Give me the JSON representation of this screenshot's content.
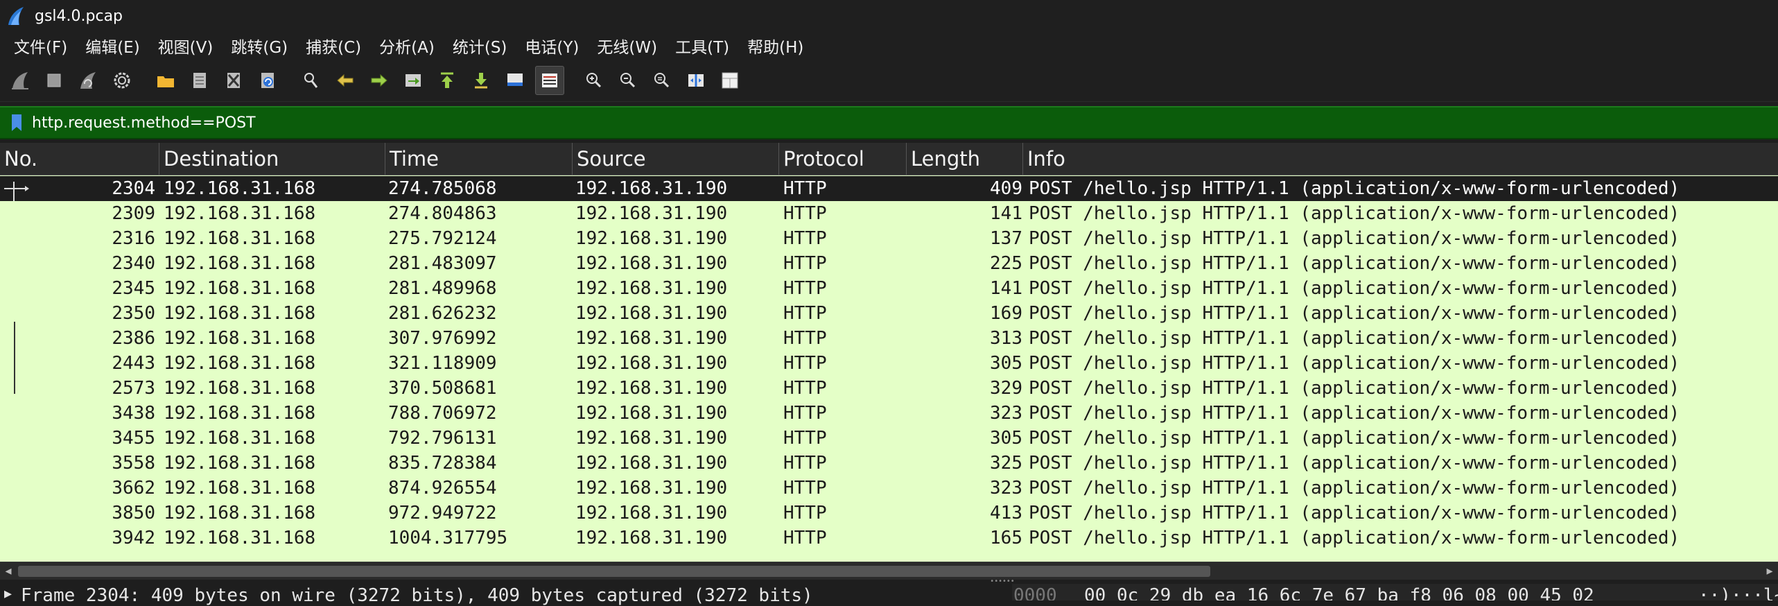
{
  "window": {
    "title": "gsl4.0.pcap"
  },
  "menu": [
    "文件(F)",
    "编辑(E)",
    "视图(V)",
    "跳转(G)",
    "捕获(C)",
    "分析(A)",
    "统计(S)",
    "电话(Y)",
    "无线(W)",
    "工具(T)",
    "帮助(H)"
  ],
  "toolbar": {
    "icons": [
      "shark-fin-start-icon",
      "stop-square-icon",
      "shark-fin-restart-icon",
      "capture-options-gear-icon",
      "open-folder-icon",
      "save-file-icon",
      "close-file-icon",
      "reload-icon",
      "find-packet-icon",
      "go-back-icon",
      "go-forward-icon",
      "go-to-packet-icon",
      "go-first-icon",
      "go-last-icon",
      "auto-scroll-icon",
      "colorize-icon",
      "zoom-in-icon",
      "zoom-out-icon",
      "zoom-normal-icon",
      "resize-columns-icon",
      "layout-pane-icon"
    ]
  },
  "filter": {
    "value": "http.request.method==POST"
  },
  "columns": [
    "No.",
    "Destination",
    "Time",
    "Source",
    "Protocol",
    "Length",
    "Info"
  ],
  "packets": [
    {
      "no": "2304",
      "dst": "192.168.31.168",
      "time": "274.785068",
      "src": "192.168.31.190",
      "proto": "HTTP",
      "len": "409",
      "info": "POST /hello.jsp HTTP/1.1  (application/x-www-form-urlencoded)"
    },
    {
      "no": "2309",
      "dst": "192.168.31.168",
      "time": "274.804863",
      "src": "192.168.31.190",
      "proto": "HTTP",
      "len": "141",
      "info": "POST /hello.jsp HTTP/1.1  (application/x-www-form-urlencoded)"
    },
    {
      "no": "2316",
      "dst": "192.168.31.168",
      "time": "275.792124",
      "src": "192.168.31.190",
      "proto": "HTTP",
      "len": "137",
      "info": "POST /hello.jsp HTTP/1.1  (application/x-www-form-urlencoded)"
    },
    {
      "no": "2340",
      "dst": "192.168.31.168",
      "time": "281.483097",
      "src": "192.168.31.190",
      "proto": "HTTP",
      "len": "225",
      "info": "POST /hello.jsp HTTP/1.1  (application/x-www-form-urlencoded)"
    },
    {
      "no": "2345",
      "dst": "192.168.31.168",
      "time": "281.489968",
      "src": "192.168.31.190",
      "proto": "HTTP",
      "len": "141",
      "info": "POST /hello.jsp HTTP/1.1  (application/x-www-form-urlencoded)"
    },
    {
      "no": "2350",
      "dst": "192.168.31.168",
      "time": "281.626232",
      "src": "192.168.31.190",
      "proto": "HTTP",
      "len": "169",
      "info": "POST /hello.jsp HTTP/1.1  (application/x-www-form-urlencoded)"
    },
    {
      "no": "2386",
      "dst": "192.168.31.168",
      "time": "307.976992",
      "src": "192.168.31.190",
      "proto": "HTTP",
      "len": "313",
      "info": "POST /hello.jsp HTTP/1.1  (application/x-www-form-urlencoded)"
    },
    {
      "no": "2443",
      "dst": "192.168.31.168",
      "time": "321.118909",
      "src": "192.168.31.190",
      "proto": "HTTP",
      "len": "305",
      "info": "POST /hello.jsp HTTP/1.1  (application/x-www-form-urlencoded)"
    },
    {
      "no": "2573",
      "dst": "192.168.31.168",
      "time": "370.508681",
      "src": "192.168.31.190",
      "proto": "HTTP",
      "len": "329",
      "info": "POST /hello.jsp HTTP/1.1  (application/x-www-form-urlencoded)"
    },
    {
      "no": "3438",
      "dst": "192.168.31.168",
      "time": "788.706972",
      "src": "192.168.31.190",
      "proto": "HTTP",
      "len": "323",
      "info": "POST /hello.jsp HTTP/1.1  (application/x-www-form-urlencoded)"
    },
    {
      "no": "3455",
      "dst": "192.168.31.168",
      "time": "792.796131",
      "src": "192.168.31.190",
      "proto": "HTTP",
      "len": "305",
      "info": "POST /hello.jsp HTTP/1.1  (application/x-www-form-urlencoded)"
    },
    {
      "no": "3558",
      "dst": "192.168.31.168",
      "time": "835.728384",
      "src": "192.168.31.190",
      "proto": "HTTP",
      "len": "325",
      "info": "POST /hello.jsp HTTP/1.1  (application/x-www-form-urlencoded)"
    },
    {
      "no": "3662",
      "dst": "192.168.31.168",
      "time": "874.926554",
      "src": "192.168.31.190",
      "proto": "HTTP",
      "len": "323",
      "info": "POST /hello.jsp HTTP/1.1  (application/x-www-form-urlencoded)"
    },
    {
      "no": "3850",
      "dst": "192.168.31.168",
      "time": "972.949722",
      "src": "192.168.31.190",
      "proto": "HTTP",
      "len": "413",
      "info": "POST /hello.jsp HTTP/1.1  (application/x-www-form-urlencoded)"
    },
    {
      "no": "3942",
      "dst": "192.168.31.168",
      "time": "1004.317795",
      "src": "192.168.31.190",
      "proto": "HTTP",
      "len": "165",
      "info": "POST /hello.jsp HTTP/1.1  (application/x-www-form-urlencoded)"
    }
  ],
  "details": {
    "frame_summary": "Frame 2304: 409 bytes on wire (3272 bits), 409 bytes captured (3272 bits)",
    "hex_offset": "0000",
    "hex_bytes": "00 0c 29 db ea 16 6c 7e  67 ba f8 06 08 00 45 02",
    "hex_ascii": "··)···l~ g·····E·"
  },
  "colors": {
    "row_bg": "#e4ffc7",
    "selected_bg": "#1e1e1e",
    "filter_bg": "#0b5c0b"
  }
}
